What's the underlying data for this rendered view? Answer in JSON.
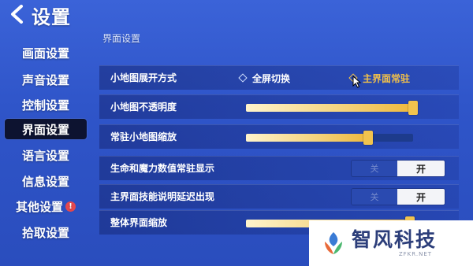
{
  "header": {
    "title": "设置",
    "back_icon": "chevron-left-icon"
  },
  "sidebar": {
    "items": [
      {
        "label": "画面设置",
        "active": false,
        "badge": ""
      },
      {
        "label": "声音设置",
        "active": false,
        "badge": ""
      },
      {
        "label": "控制设置",
        "active": false,
        "badge": ""
      },
      {
        "label": "界面设置",
        "active": true,
        "badge": ""
      },
      {
        "label": "语言设置",
        "active": false,
        "badge": ""
      },
      {
        "label": "信息设置",
        "active": false,
        "badge": ""
      },
      {
        "label": "其他设置",
        "active": false,
        "badge": "!"
      },
      {
        "label": "拾取设置",
        "active": false,
        "badge": ""
      }
    ]
  },
  "main": {
    "section_title": "界面设置",
    "minimap_mode": {
      "label": "小地图展开方式",
      "options": [
        "全屏切换",
        "主界面常驻"
      ],
      "selected": "主界面常驻"
    },
    "minimap_opacity": {
      "label": "小地图不透明度",
      "value_fraction": 1.0
    },
    "minimap_scale": {
      "label": "常驻小地图缩放",
      "value_fraction": 0.73
    },
    "hp_mp_display": {
      "label": "生命和魔力数值常驻显示",
      "off_label": "关",
      "on_label": "开",
      "state": "on"
    },
    "skill_delay": {
      "label": "主界面技能说明延迟出现",
      "off_label": "关",
      "on_label": "开",
      "state": "on"
    },
    "ui_scale": {
      "label": "整体界面缩放",
      "value_fraction": 0.98
    }
  },
  "watermark": {
    "name": "智风科技",
    "url": "ZFKR.NET"
  },
  "colors": {
    "accent": "#f2c14a",
    "background": "#2f55c9",
    "active_tab": "#0d1330"
  }
}
